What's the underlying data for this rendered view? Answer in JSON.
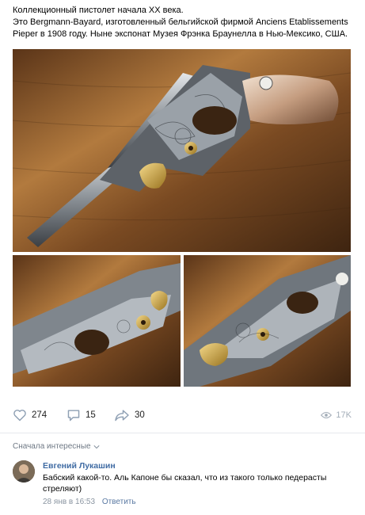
{
  "post": {
    "lines": [
      "Коллекционный пистолет начала XX века.",
      "Это Bergmann-Bayard, изготовленный бельгийской фирмой Anciens Etablissements",
      "Pieper в 1908 году. Ныне экспонат Музея Фрэнка Браунелла в Нью-Мексико, США."
    ]
  },
  "actions": {
    "likes": "274",
    "comments": "15",
    "shares": "30",
    "views": "17K"
  },
  "comments_section": {
    "sort_label": "Сначала интересные",
    "comment": {
      "author": "Евгений Лукашин",
      "text": "Бабский какой-то. Аль Капоне бы сказал, что из такого только педерасты стреляют)",
      "date": "28 янв в 16:53",
      "reply": "Ответить"
    }
  },
  "colors": {
    "link": "#3f6ba3",
    "icon": "#8fa0b4",
    "wood": "#8a5a2b"
  }
}
